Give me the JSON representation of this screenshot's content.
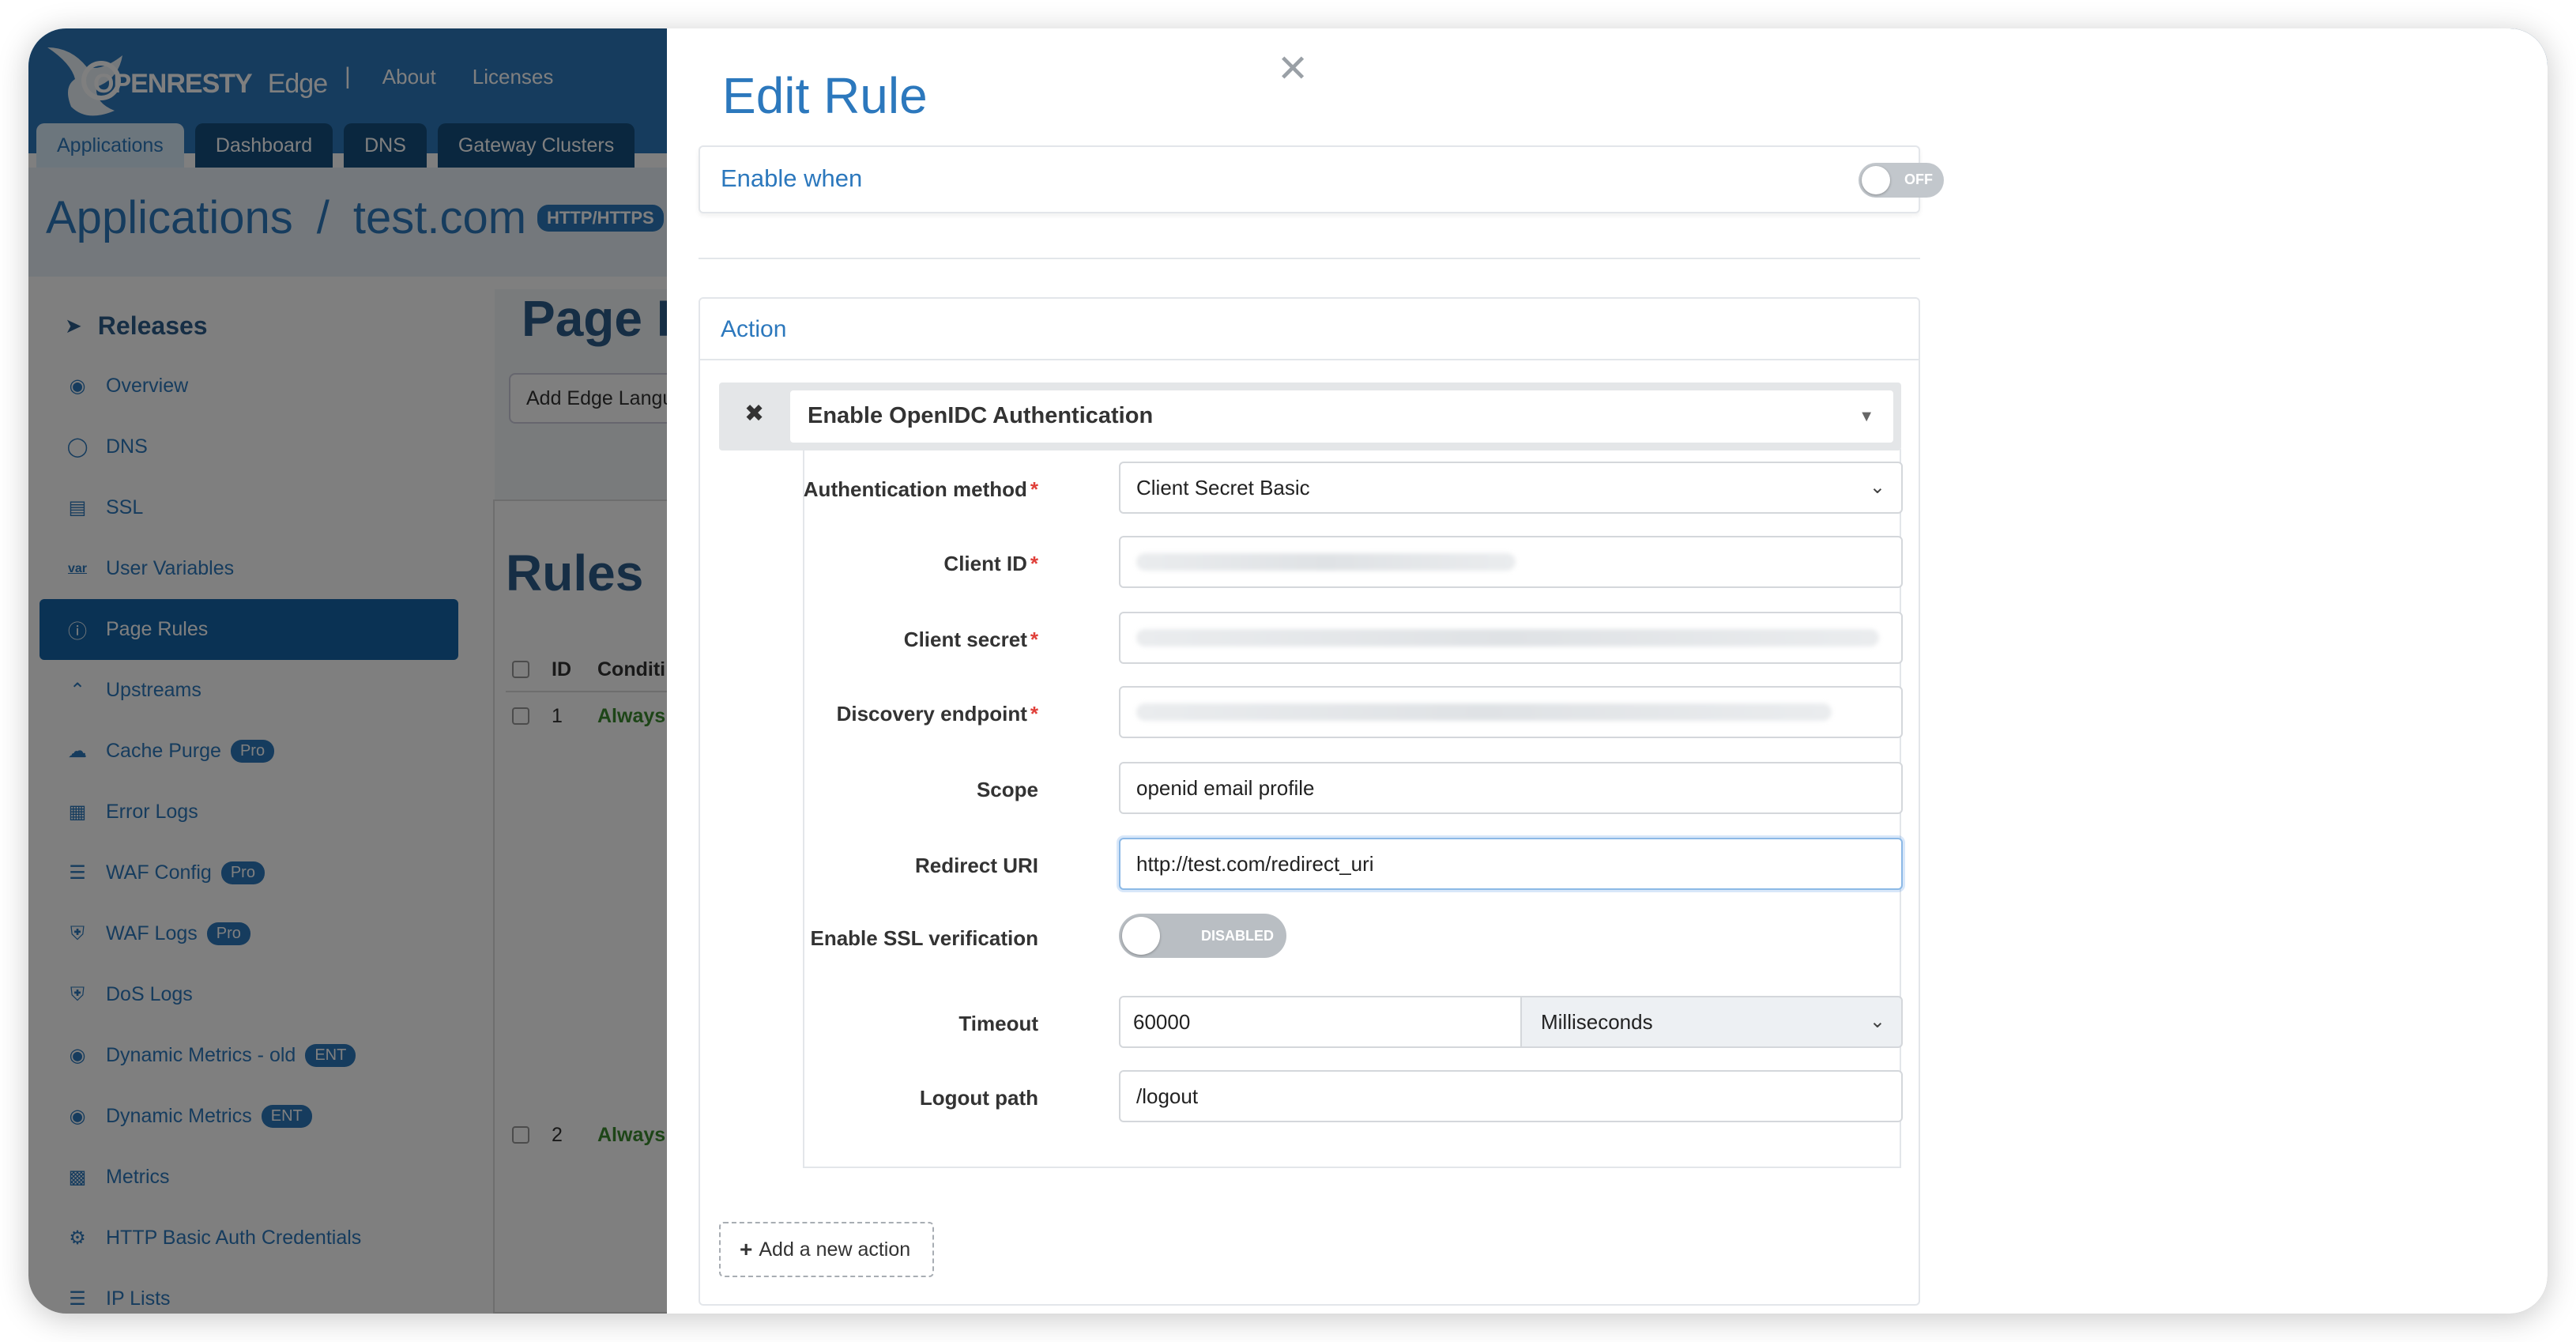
{
  "app": {
    "brand": "OPENRESTY",
    "brand_sub": "Edge",
    "top_sep": "|",
    "top_links": [
      "About",
      "Licenses"
    ],
    "tabs": [
      "Applications",
      "Dashboard",
      "DNS",
      "Gateway Clusters"
    ],
    "breadcrumb": {
      "root": "Applications",
      "sep": "/",
      "domain": "test.com",
      "badge": "HTTP/HTTPS"
    }
  },
  "sidebar": {
    "section_title": "Releases",
    "items": [
      {
        "label": "Overview",
        "icon": "speedometer-icon"
      },
      {
        "label": "DNS",
        "icon": "dns-icon"
      },
      {
        "label": "SSL",
        "icon": "certificate-icon"
      },
      {
        "label": "User Variables",
        "icon": "var-icon",
        "icon_text": "var"
      },
      {
        "label": "Page Rules",
        "icon": "page-rules-icon",
        "active": true
      },
      {
        "label": "Upstreams",
        "icon": "upstream-icon"
      },
      {
        "label": "Cache Purge",
        "icon": "cloud-icon",
        "pill": "Pro"
      },
      {
        "label": "Error Logs",
        "icon": "log-icon"
      },
      {
        "label": "WAF Config",
        "icon": "list-icon",
        "pill": "Pro"
      },
      {
        "label": "WAF Logs",
        "icon": "shield-icon",
        "pill": "Pro"
      },
      {
        "label": "DoS Logs",
        "icon": "shield-icon"
      },
      {
        "label": "Dynamic Metrics - old",
        "icon": "metrics-icon",
        "pill": "ENT"
      },
      {
        "label": "Dynamic Metrics",
        "icon": "metrics-icon",
        "pill": "ENT"
      },
      {
        "label": "Metrics",
        "icon": "bar-chart-icon"
      },
      {
        "label": "HTTP Basic Auth Credentials",
        "icon": "key-icon"
      },
      {
        "label": "IP Lists",
        "icon": "list-icon"
      }
    ]
  },
  "main": {
    "page_title_partial": "Page R",
    "add_button_partial": "Add Edge Langu",
    "rules_title": "Rules",
    "table_headers": {
      "id": "ID",
      "condition": "Conditi"
    },
    "rows": [
      {
        "id": "1",
        "condition": "Always"
      },
      {
        "id": "2",
        "condition": "Always"
      }
    ]
  },
  "modal": {
    "close_icon": "close-icon",
    "title": "Edit Rule",
    "enable_when": {
      "label": "Enable when",
      "toggle_text": "OFF",
      "on": false
    },
    "action": {
      "label": "Action",
      "remove_icon": "times-icon",
      "selected": "Enable OpenIDC Authentication",
      "fields": {
        "auth_method": {
          "label": "Authentication method",
          "value": "Client Secret Basic",
          "required": true
        },
        "client_id": {
          "label": "Client ID",
          "required": true
        },
        "client_secret": {
          "label": "Client secret",
          "required": true
        },
        "discovery": {
          "label": "Discovery endpoint",
          "required": true
        },
        "scope": {
          "label": "Scope",
          "value": "openid email profile"
        },
        "redirect_uri": {
          "label": "Redirect URI",
          "value": "http://test.com/redirect_uri"
        },
        "ssl_verify": {
          "label": "Enable SSL verification",
          "toggle_text": "DISABLED",
          "on": false
        },
        "timeout": {
          "label": "Timeout",
          "value": "60000",
          "unit": "Milliseconds"
        },
        "logout_path": {
          "label": "Logout path",
          "value": "/logout"
        }
      },
      "required_mark": "*"
    },
    "add_action": "Add a new action"
  }
}
